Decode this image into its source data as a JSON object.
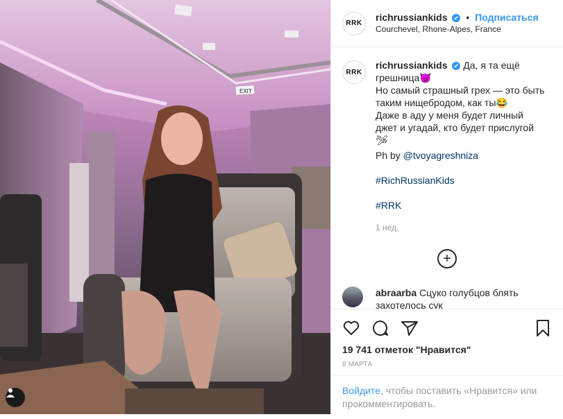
{
  "post": {
    "avatar_text": "RRK",
    "username": "richrussiankids",
    "verified_mark": "✔",
    "separator": "•",
    "follow_label": "Подписаться",
    "location": "Courchevel, Rhone-Alpes, France"
  },
  "caption": {
    "username": "richrussiankids",
    "line1": "Да, я та ещё грешница😈",
    "line2": "Но самый страшный грех — это быть таким нищебродом, как ты😂",
    "line3": "Даже в аду у меня будет личный джет и угадай, кто будет прислугой 🛩",
    "credit_prefix": "Ph by ",
    "credit_mention": "@tvoyagreshniza",
    "hashtag1": "#RichRussianKids",
    "hashtag2": "#RRK",
    "time": "1 нед."
  },
  "load_more": "+",
  "reply": {
    "username": "abraarba",
    "text": "Сцуко голубцов блять захотелось",
    "suffix": " сук"
  },
  "actions": {
    "likes": "19 741 отметок \"Нравится\"",
    "date": "8 МАРТА"
  },
  "login_prompt": {
    "link": "Войдите",
    "rest": ", чтобы поставить «Нравится» или прокомментировать."
  },
  "icons": {
    "like": "heart-icon",
    "comment": "comment-icon",
    "share": "share-icon",
    "save": "bookmark-icon",
    "tag": "person-icon"
  },
  "colors": {
    "accent": "#3897f0",
    "text": "#262626",
    "muted": "#999999"
  }
}
